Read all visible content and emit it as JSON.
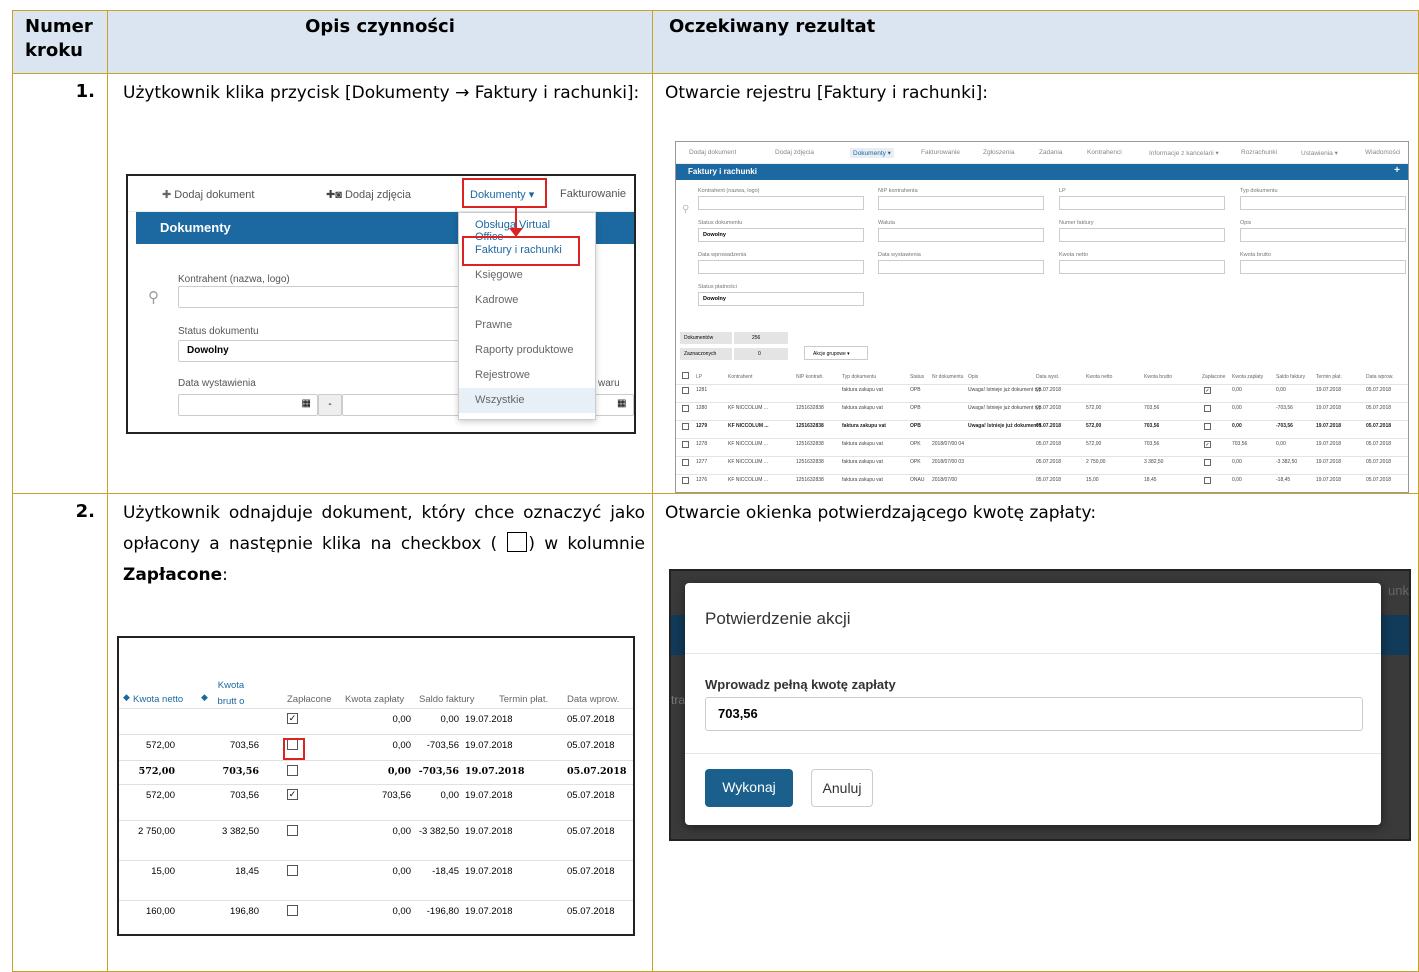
{
  "header": {
    "col1": "Numer kroku",
    "col2": "Opis czynności",
    "col3": "Oczekiwany rezultat"
  },
  "step1": {
    "num": "1.",
    "desc": "Użytkownik klika przycisk [Dokumenty → Faktury i rachunki]:",
    "result": "Otwarcie rejestru [Faktury i rachunki]:"
  },
  "step2": {
    "num": "2.",
    "desc_a": "Użytkownik odnajduje dokument, który chce oznaczyć jako opłacony a następnie klika na checkbox (",
    "desc_b": ") w kolumnie",
    "desc_bold": "Zapłacone",
    "desc_end": ":",
    "result": "Otwarcie okienka potwierdzającego kwotę zapłaty:"
  },
  "shot1": {
    "add_doc": "Dodaj dokument",
    "add_photo": "Dodaj zdjęcia",
    "menu": "Dokumenty ▾",
    "invoicing": "Fakturowanie",
    "panel_title": "Dokumenty",
    "kontrahent": "Kontrahent (nazwa, logo)",
    "status": "Status dokumentu",
    "status_val": "Dowolny",
    "date": "Data wystawienia",
    "date_sep": "-",
    "right_frag": "waru",
    "dropdown": [
      "Obsługa Virtual Office",
      "Faktury i rachunki",
      "Księgowe",
      "Kadrowe",
      "Prawne",
      "Raporty produktowe",
      "Rejestrowe",
      "Wszystkie"
    ]
  },
  "shot2": {
    "nav": [
      "Dodaj dokument",
      "Dodaj zdjęcia",
      "Dokumenty ▾",
      "Fakturowanie",
      "Zgłoszenia",
      "Zadania",
      "Kontrahenci",
      "Informacje z kancelarii ▾",
      "Rozrachunki",
      "Ustawienia ▾",
      "Wiadomości"
    ],
    "title": "Faktury i rachunki",
    "plus": "+",
    "filters": [
      "Kontrahent (nazwa, logo)",
      "NIP kontrahenta",
      "LP",
      "Typ dokumentu",
      "Status dokumentu",
      "Waluta",
      "Numer faktury",
      "Opis",
      "Data wprowadzenia",
      "Data wystawienia",
      "Kwota netto",
      "Kwota brutto",
      "Status płatności"
    ],
    "dowolny": "Dowolny",
    "doc_count_label": "Dokumentów",
    "doc_count": "256",
    "sel_label": "Zaznaczonych",
    "sel_count": "0",
    "group": "Akcje grupowe ▾",
    "cols": [
      "LP",
      "Kontrahent",
      "NIP kontrah.",
      "Typ dokumentu",
      "Status",
      "Nr dokumentu",
      "Opis",
      "Data wyst.",
      "Kwota netto",
      "Kwota brutto",
      "Zapłacone",
      "Kwota zapłaty",
      "Saldo faktury",
      "Termin płat.",
      "Data wprow."
    ],
    "rows": [
      [
        "1281",
        "",
        "",
        "faktura zakupu vat",
        "OPB",
        "",
        "Uwaga! Istnieje już dokument typ",
        "05.07.2018",
        "",
        "",
        "✓",
        "0,00",
        "0,00",
        "19.07.2018",
        "05.07.2018"
      ],
      [
        "1280",
        "KF NICCOLUM ...",
        "1251632838",
        "faktura zakupu vat",
        "OPB",
        "",
        "Uwaga! Istnieje już dokument typ",
        "05.07.2018",
        "572,00",
        "703,56",
        "",
        "0,00",
        "-703,56",
        "19.07.2018",
        "05.07.2018"
      ],
      [
        "1279",
        "KF NICCOLUM ...",
        "1251632838",
        "faktura zakupu vat",
        "OPB",
        "",
        "Uwaga! Istnieje już dokument t",
        "05.07.2018",
        "572,00",
        "703,56",
        "",
        "0,00",
        "-703,56",
        "19.07.2018",
        "05.07.2018"
      ],
      [
        "1278",
        "KF NICCOLUM ...",
        "1251632838",
        "faktura zakupu vat",
        "OPK",
        "2018/07/00 04",
        "",
        "05.07.2018",
        "572,00",
        "703,56",
        "✓",
        "703,56",
        "0,00",
        "19.07.2018",
        "05.07.2018"
      ],
      [
        "1277",
        "KF NICCOLUM ...",
        "1251632838",
        "faktura zakupu vat",
        "OPK",
        "2018/07/00 03",
        "",
        "05.07.2018",
        "2 750,00",
        "3 382,50",
        "",
        "0,00",
        "-3 382,50",
        "19.07.2018",
        "05.07.2018"
      ],
      [
        "1276",
        "KF NICCOLUM ...",
        "1251632838",
        "faktura zakupu vat",
        "ONAU",
        "2018/07/00",
        "",
        "05.07.2018",
        "15,00",
        "18,45",
        "",
        "0,00",
        "-18,45",
        "19.07.2018",
        "05.07.2018"
      ]
    ]
  },
  "shot3": {
    "h_net": "Kwota netto",
    "h_gross": "Kwota brutt o",
    "h_paid": "Zapłacone",
    "h_amt": "Kwota zapłaty",
    "h_bal": "Saldo faktury",
    "h_due": "Termin płat.",
    "h_entry": "Data wprow.",
    "rows": [
      {
        "net": "",
        "gross": "",
        "checked": true,
        "amt": "0,00",
        "bal": "0,00",
        "due": "19.07.2018",
        "entry": "05.07.2018",
        "bold": false
      },
      {
        "net": "572,00",
        "gross": "703,56",
        "checked": false,
        "amt": "0,00",
        "bal": "-703,56",
        "due": "19.07.2018",
        "entry": "05.07.2018",
        "bold": false
      },
      {
        "net": "572,00",
        "gross": "703,56",
        "checked": false,
        "amt": "0,00",
        "bal": "-703,56",
        "due": "19.07.2018",
        "entry": "05.07.2018",
        "bold": true
      },
      {
        "net": "572,00",
        "gross": "703,56",
        "checked": true,
        "amt": "703,56",
        "bal": "0,00",
        "due": "19.07.2018",
        "entry": "05.07.2018",
        "bold": false
      },
      {
        "net": "2 750,00",
        "gross": "3 382,50",
        "checked": false,
        "amt": "0,00",
        "bal": "-3 382,50",
        "due": "19.07.2018",
        "entry": "05.07.2018",
        "bold": false
      },
      {
        "net": "15,00",
        "gross": "18,45",
        "checked": false,
        "amt": "0,00",
        "bal": "-18,45",
        "due": "19.07.2018",
        "entry": "05.07.2018",
        "bold": false
      },
      {
        "net": "160,00",
        "gross": "196,80",
        "checked": false,
        "amt": "0,00",
        "bal": "-196,80",
        "due": "19.07.2018",
        "entry": "05.07.2018",
        "bold": false
      }
    ]
  },
  "shot4": {
    "title": "Potwierdzenie akcji",
    "label": "Wprowadz pełną kwotę zapłaty",
    "value": "703,56",
    "ok": "Wykonaj",
    "cancel": "Anuluj",
    "bg_frag": "unk",
    "bg_frag2": "tra"
  }
}
